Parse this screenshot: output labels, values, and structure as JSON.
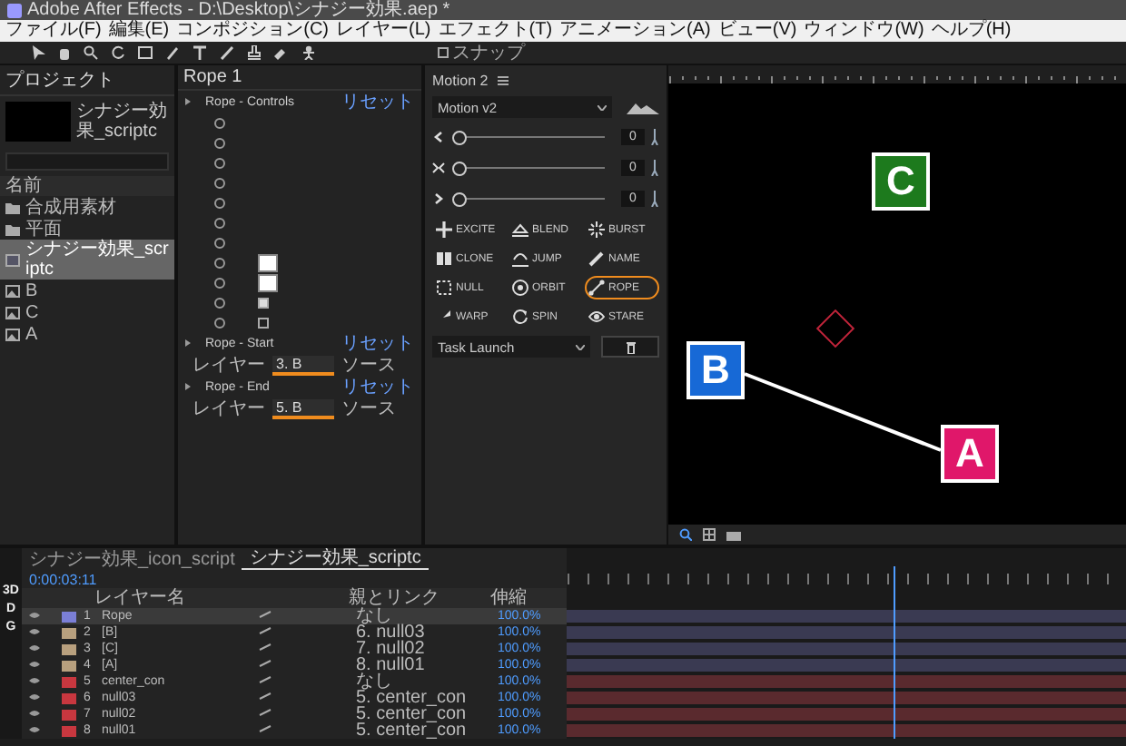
{
  "window": {
    "title": "Adobe After Effects - D:\\Desktop\\シナジー効果.aep *"
  },
  "menu": [
    "ファイル(F)",
    "編集(E)",
    "コンポジション(C)",
    "レイヤー(L)",
    "エフェクト(T)",
    "アニメーション(A)",
    "ビュー(V)",
    "ウィンドウ(W)",
    "ヘルプ(H)"
  ],
  "toolbar": {
    "snap": {
      "label": "スナップ",
      "checked": false
    }
  },
  "project": {
    "tab": "プロジェクト",
    "comp_name": "シナジー効果_scriptc",
    "column": "名前",
    "items": [
      {
        "name": "合成用素材",
        "kind": "folder",
        "selected": false
      },
      {
        "name": "平面",
        "kind": "folder",
        "selected": false
      },
      {
        "name": "シナジー効果_scriptc",
        "kind": "comp",
        "selected": true
      },
      {
        "name": "B",
        "kind": "footage",
        "selected": false
      },
      {
        "name": "C",
        "kind": "footage",
        "selected": false
      },
      {
        "name": "A",
        "kind": "footage",
        "selected": false
      }
    ]
  },
  "effects": {
    "tab": "Rope 1",
    "groups": [
      {
        "name": "Rope - Controls",
        "reset": "リセット",
        "rows": [
          {
            "kind": "param"
          },
          {
            "kind": "param"
          },
          {
            "kind": "param"
          },
          {
            "kind": "param"
          },
          {
            "kind": "param"
          },
          {
            "kind": "param"
          },
          {
            "kind": "param"
          },
          {
            "kind": "color",
            "color": "#ffffff"
          },
          {
            "kind": "color",
            "color": "#ffffff"
          },
          {
            "kind": "checkbox",
            "checked": true
          },
          {
            "kind": "checkbox",
            "checked": false
          }
        ]
      },
      {
        "name": "Rope - Start",
        "reset": "リセット",
        "layer_label": "レイヤー",
        "layer": "3. B",
        "source": "ソース"
      },
      {
        "name": "Rope - End",
        "reset": "リセット",
        "layer_label": "レイヤー",
        "layer": "5. B",
        "source": "ソース"
      }
    ]
  },
  "motion": {
    "title": "Motion 2",
    "preset": "Motion v2",
    "sliders": [
      {
        "value": "0",
        "level": 0
      },
      {
        "value": "0",
        "level": 0
      },
      {
        "value": "0",
        "level": 0
      }
    ],
    "buttons": [
      {
        "label": "EXCITE",
        "highlighted": false
      },
      {
        "label": "BLEND",
        "highlighted": false
      },
      {
        "label": "BURST",
        "highlighted": false
      },
      {
        "label": "CLONE",
        "highlighted": false
      },
      {
        "label": "JUMP",
        "highlighted": false
      },
      {
        "label": "NAME",
        "highlighted": false
      },
      {
        "label": "NULL",
        "highlighted": false
      },
      {
        "label": "ORBIT",
        "highlighted": false
      },
      {
        "label": "ROPE",
        "highlighted": true
      },
      {
        "label": "WARP",
        "highlighted": false
      },
      {
        "label": "SPIN",
        "highlighted": false
      },
      {
        "label": "STARE",
        "highlighted": false
      }
    ],
    "task": "Task Launch"
  },
  "viewer": {
    "markers": [
      {
        "label": "C",
        "color": "#1d7a1d"
      },
      {
        "label": "B",
        "color": "#1769d6"
      },
      {
        "label": "A",
        "color": "#e0176a"
      }
    ]
  },
  "timeline": {
    "tabs": [
      {
        "label": "シナジー効果_icon_script",
        "selected": false
      },
      {
        "label": "シナジー効果_scriptc",
        "selected": true
      }
    ],
    "timecode": "0:00:03:11",
    "strip": [
      "3D",
      "D",
      "G"
    ],
    "columns": {
      "name": "レイヤー名",
      "parent": "親とリンク",
      "stretch": "伸縮"
    },
    "layers": [
      {
        "num": "1",
        "name": "Rope",
        "color": "#7b7fd6",
        "selected": true,
        "parent": "なし",
        "stretch": "100.0%"
      },
      {
        "num": "2",
        "name": "[B]",
        "color": "#b8a07e",
        "selected": false,
        "parent": "6. null03",
        "stretch": "100.0%"
      },
      {
        "num": "3",
        "name": "[C]",
        "color": "#b8a07e",
        "selected": false,
        "parent": "7. null02",
        "stretch": "100.0%"
      },
      {
        "num": "4",
        "name": "[A]",
        "color": "#b8a07e",
        "selected": false,
        "parent": "8. null01",
        "stretch": "100.0%"
      },
      {
        "num": "5",
        "name": "center_con",
        "color": "#c8373f",
        "selected": false,
        "parent": "なし",
        "stretch": "100.0%"
      },
      {
        "num": "6",
        "name": "null03",
        "color": "#c8373f",
        "selected": false,
        "parent": "5. center_con",
        "stretch": "100.0%"
      },
      {
        "num": "7",
        "name": "null02",
        "color": "#c8373f",
        "selected": false,
        "parent": "5. center_con",
        "stretch": "100.0%"
      },
      {
        "num": "8",
        "name": "null01",
        "color": "#c8373f",
        "selected": false,
        "parent": "5. center_con",
        "stretch": "100.0%"
      }
    ]
  }
}
